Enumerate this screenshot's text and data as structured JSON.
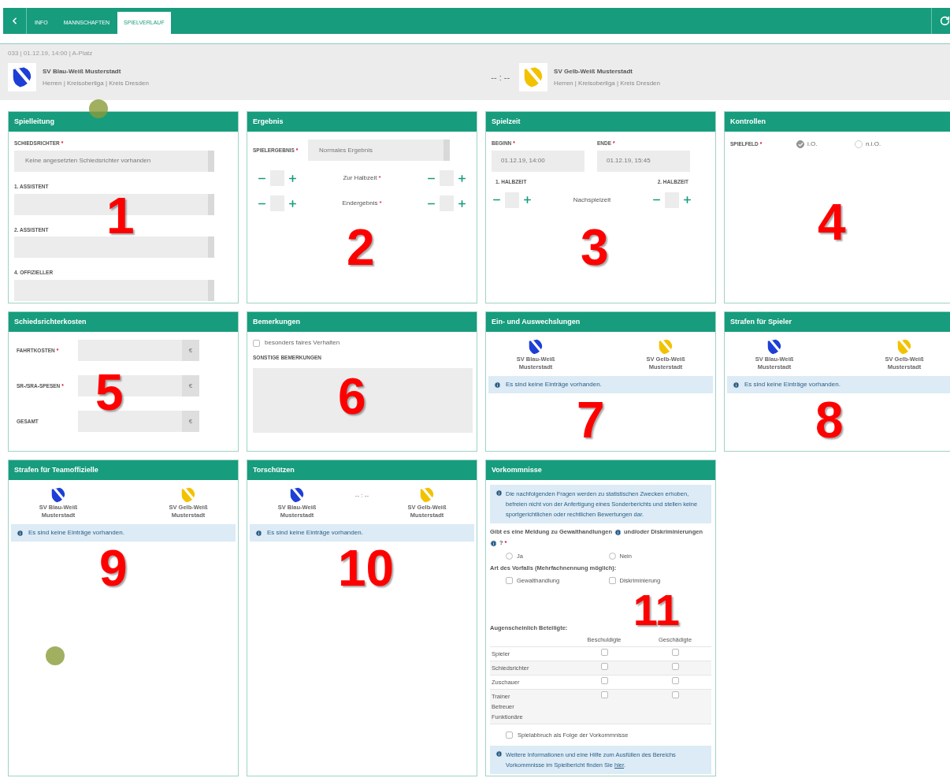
{
  "nav": {
    "tabs": [
      {
        "label": "INFO",
        "selected": false
      },
      {
        "label": "MANNSCHAFTEN",
        "selected": false
      },
      {
        "label": "SPIELVERLAUF",
        "selected": true
      }
    ]
  },
  "match": {
    "meta": "033 | 01.12.19, 14:00 | A-Platz",
    "score": "-- : --",
    "teams": [
      {
        "name": "SV Blau-Weiß Musterstadt",
        "info": "Herren | Kreisoberliga | Kreis Dresden",
        "color": "#1d3fd6"
      },
      {
        "name": "SV Gelb-Weiß Musterstadt",
        "info": "Herren | Kreisoberliga | Kreis Dresden",
        "color": "#f2c200"
      }
    ]
  },
  "panels": [
    {
      "kind": "officials",
      "title": "Spielleitung",
      "marker": "1",
      "fields": [
        {
          "label": "SCHIEDSRICHTER",
          "required": "*",
          "value": "Keine angesetzten Schiedsrichter vorhanden"
        },
        {
          "label": "1. ASSISTENT"
        },
        {
          "label": "2. ASSISTENT"
        },
        {
          "label": "4. OFFIZIELLER"
        }
      ]
    },
    {
      "kind": "result",
      "title": "Ergebnis",
      "marker": "2",
      "label": "SPIELERGEBNIS",
      "required": "*",
      "value": "Normales Ergebnis",
      "rows": [
        {
          "label": "Zur Halbzeit",
          "required": "*"
        },
        {
          "label": "Endergebnis",
          "required": "*"
        }
      ]
    },
    {
      "kind": "time",
      "title": "Spielzeit",
      "marker": "3",
      "start": {
        "label": "BEGINN",
        "required": "*",
        "value": "01.12.19, 14:00"
      },
      "end": {
        "label": "ENDE",
        "required": "*",
        "value": "01.12.19, 15:45"
      },
      "halves": [
        "1. HALBZEIT",
        "2. HALBZEIT"
      ],
      "middle": "Nachspielzeit"
    },
    {
      "kind": "checks",
      "title": "Kontrollen",
      "marker": "4",
      "label": "SPIELFELD",
      "required": "*",
      "options": [
        {
          "label": "i.O.",
          "selected": true
        },
        {
          "label": "n.i.O.",
          "selected": false
        }
      ]
    },
    {
      "kind": "costs",
      "title": "Schiedsrichterkosten",
      "marker": "5",
      "rows": [
        {
          "label": "FAHRTKOSTEN",
          "required": "*",
          "unit": "€"
        },
        {
          "label": "SR-/SRA-SPESEN",
          "required": "*",
          "unit": "€"
        },
        {
          "label": "GESAMT",
          "unit": "€"
        }
      ]
    },
    {
      "kind": "remarks",
      "title": "Bemerkungen",
      "marker": "6",
      "checkbox": {
        "label": "besonders faires Verhalten",
        "checked": false
      },
      "textarea_label": "SONSTIGE BEMERKUNGEN"
    },
    {
      "kind": "teams",
      "title": "Ein- und Auswechslungen",
      "marker": "7",
      "teams": [
        {
          "name": "SV Blau-Weiß Musterstadt",
          "color": "#1d3fd6"
        },
        {
          "name": "SV Gelb-Weiß Musterstadt",
          "color": "#f2c200"
        }
      ],
      "info": "Es sind keine Einträge vorhanden."
    },
    {
      "kind": "teams",
      "title": "Strafen für Spieler",
      "marker": "8",
      "teams": [
        {
          "name": "SV Blau-Weiß Musterstadt",
          "color": "#1d3fd6"
        },
        {
          "name": "SV Gelb-Weiß Musterstadt",
          "color": "#f2c200"
        }
      ],
      "info": "Es sind keine Einträge vorhanden."
    },
    {
      "kind": "teams",
      "title": "Strafen für Teamoffizielle",
      "marker": "9",
      "teams": [
        {
          "name": "SV Blau-Weiß Musterstadt",
          "color": "#1d3fd6"
        },
        {
          "name": "SV Gelb-Weiß Musterstadt",
          "color": "#f2c200"
        }
      ],
      "info": "Es sind keine Einträge vorhanden."
    },
    {
      "kind": "teams",
      "title": "Torschützen",
      "marker": "10",
      "score": "-- : --",
      "teams": [
        {
          "name": "SV Blau-Weiß Musterstadt",
          "color": "#1d3fd6"
        },
        {
          "name": "SV Gelb-Weiß Musterstadt",
          "color": "#f2c200"
        }
      ],
      "info": "Es sind keine Einträge vorhanden."
    },
    {
      "kind": "incidents",
      "title": "Vorkommnisse",
      "marker": "11",
      "intro": "Die nachfolgenden Fragen werden zu statistischen Zwecken erhoben, befreien nicht von der Anfertigung eines Sonderberichts und stellen keine sportgerichtlichen oder rechtlichen Bewertungen dar.",
      "question": [
        "Gibt es eine Meldung zu Gewalthandlungen",
        "und/oder Diskriminierungen",
        "?"
      ],
      "required": "*",
      "answers": [
        {
          "label": "Ja",
          "selected": false
        },
        {
          "label": "Nein",
          "selected": false
        }
      ],
      "type_label": "Art des Vorfalls (Mehrfachnennung möglich):",
      "types": [
        {
          "label": "Gewalthandlung",
          "checked": false
        },
        {
          "label": "Diskriminierung",
          "checked": false
        }
      ],
      "parties_label": "Augenscheinlich Beteiligte:",
      "columns": [
        "Beschuldigte",
        "Geschädigte"
      ],
      "rows": [
        {
          "label": "Spieler",
          "accused": false,
          "injured": false
        },
        {
          "label": "Schiedsrichter",
          "accused": false,
          "injured": false
        },
        {
          "label": "Zuschauer",
          "accused": false,
          "injured": false
        },
        {
          "label": "Trainer\nBetreuer\nFunktionäre",
          "accused": false,
          "injured": false
        }
      ],
      "abort": {
        "label": "Spielabbruch als Folge der Vorkommnisse",
        "checked": false
      },
      "help": {
        "text": "Weitere Informationen und eine Hilfe zum Ausfüllen des Bereichs Vorkommnisse im Spielbericht finden Sie",
        "link": "hier",
        "end": "."
      }
    }
  ]
}
